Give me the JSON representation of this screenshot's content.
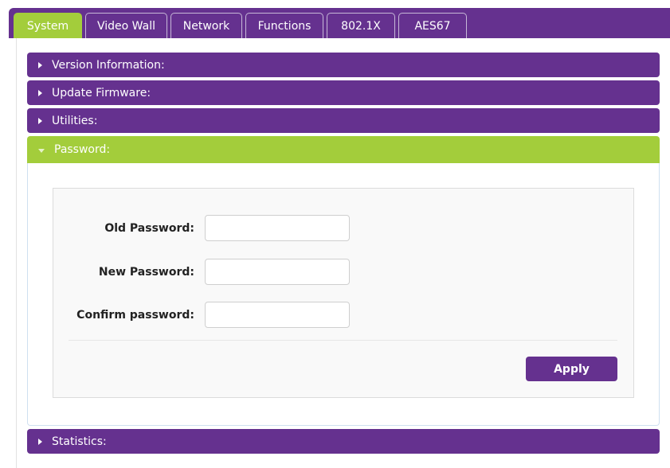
{
  "tabs": [
    {
      "label": "System",
      "active": true
    },
    {
      "label": "Video Wall",
      "active": false
    },
    {
      "label": "Network",
      "active": false
    },
    {
      "label": "Functions",
      "active": false
    },
    {
      "label": "802.1X",
      "active": false
    },
    {
      "label": "AES67",
      "active": false
    }
  ],
  "sections": [
    {
      "label": "Version Information:",
      "expanded": false
    },
    {
      "label": "Update Firmware:",
      "expanded": false
    },
    {
      "label": "Utilities:",
      "expanded": false
    },
    {
      "label": "Password:",
      "expanded": true
    },
    {
      "label": "Statistics:",
      "expanded": false
    }
  ],
  "password_form": {
    "old_label": "Old Password:",
    "old_value": "",
    "new_label": "New Password:",
    "new_value": "",
    "confirm_label": "Confirm password:",
    "confirm_value": "",
    "apply_label": "Apply"
  },
  "colors": {
    "brand_purple": "#65318f",
    "active_green": "#a3cd3b"
  }
}
